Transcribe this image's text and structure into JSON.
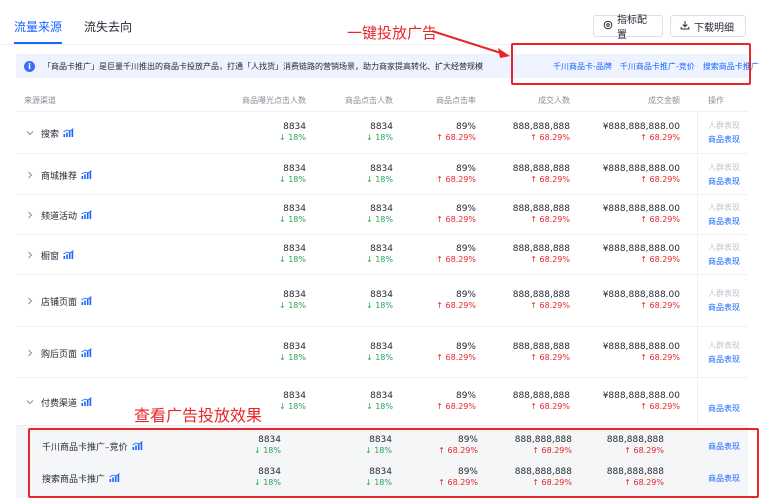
{
  "tabs": [
    {
      "label": "流量来源",
      "active": true
    },
    {
      "label": "流失去向",
      "active": false
    }
  ],
  "toolbar": {
    "metric_label": "指标配置",
    "download_label": "下载明细"
  },
  "notice": {
    "text": "「商品卡推广」是巨量千川推出的商品卡投放产品，打通「人找货」消费链路的营销场景，助力商家提高转化、扩大经营规模",
    "links": [
      "千川商品卡-品牌",
      "千川商品卡推广-竞价",
      "搜索商品卡推广"
    ]
  },
  "annotations": {
    "top": "一键投放广告",
    "bottom": "查看广告投放效果"
  },
  "columns": [
    "来源渠道",
    "商品曝光点击人数",
    "商品点击人数",
    "商品点击率",
    "成交人数",
    "成交金额",
    "操作"
  ],
  "ops": {
    "crowd": "人群表现",
    "product": "商品表现"
  },
  "rows": [
    {
      "name": "搜索",
      "expanded": true,
      "c1": "8834",
      "d1": "↓ 18%",
      "c2": "8834",
      "d2": "↓ 18%",
      "c3": "89%",
      "d3": "↑ 68.29%",
      "c4": "888,888,888",
      "d4": "↑ 68.29%",
      "c5": "¥888,888,888.00",
      "d5": "↑ 68.29%"
    },
    {
      "name": "商城推荐",
      "expanded": false,
      "c1": "8834",
      "d1": "↓ 18%",
      "c2": "8834",
      "d2": "↓ 18%",
      "c3": "89%",
      "d3": "↑ 68.29%",
      "c4": "888,888,888",
      "d4": "↑ 68.29%",
      "c5": "¥888,888,888.00",
      "d5": "↑ 68.29%"
    },
    {
      "name": "频道活动",
      "expanded": false,
      "c1": "8834",
      "d1": "↓ 18%",
      "c2": "8834",
      "d2": "↓ 18%",
      "c3": "89%",
      "d3": "↑ 68.29%",
      "c4": "888,888,888",
      "d4": "↑ 68.29%",
      "c5": "¥888,888,888.00",
      "d5": "↑ 68.29%"
    },
    {
      "name": "橱窗",
      "expanded": false,
      "c1": "8834",
      "d1": "↓ 18%",
      "c2": "8834",
      "d2": "↓ 18%",
      "c3": "89%",
      "d3": "↑ 68.29%",
      "c4": "888,888,888",
      "d4": "↑ 68.29%",
      "c5": "¥888,888,888.00",
      "d5": "↑ 68.29%"
    },
    {
      "name": "店铺页面",
      "expanded": false,
      "c1": "8834",
      "d1": "↓ 18%",
      "c2": "8834",
      "d2": "↓ 18%",
      "c3": "89%",
      "d3": "↑ 68.29%",
      "c4": "888,888,888",
      "d4": "↑ 68.29%",
      "c5": "¥888,888,888.00",
      "d5": "↑ 68.29%"
    },
    {
      "name": "购后页面",
      "expanded": false,
      "c1": "8834",
      "d1": "↓ 18%",
      "c2": "8834",
      "d2": "↓ 18%",
      "c3": "89%",
      "d3": "↑ 68.29%",
      "c4": "888,888,888",
      "d4": "↑ 68.29%",
      "c5": "¥888,888,888.00",
      "d5": "↑ 68.29%"
    },
    {
      "name": "付费渠道",
      "expanded": true,
      "c1": "8834",
      "d1": "↓ 18%",
      "c2": "8834",
      "d2": "↓ 18%",
      "c3": "89%",
      "d3": "↑ 68.29%",
      "c4": "888,888,888",
      "d4": "↑ 68.29%",
      "c5": "¥888,888,888.00",
      "d5": "↑ 68.29%"
    }
  ],
  "sub_rows": [
    {
      "name": "千川商品卡推广–竞价",
      "c1": "8834",
      "d1": "↓ 18%",
      "c2": "8834",
      "d2": "↓ 18%",
      "c3": "89%",
      "d3": "↑ 68.29%",
      "c4": "888,888,888",
      "d4": "↑ 68.29%",
      "c5": "888,888,888",
      "d5": "↑ 68.29%"
    },
    {
      "name": "搜索商品卡推广",
      "c1": "8834",
      "d1": "↓ 18%",
      "c2": "8834",
      "d2": "↓ 18%",
      "c3": "89%",
      "d3": "↑ 68.29%",
      "c4": "888,888,888",
      "d4": "↑ 68.29%",
      "c5": "888,888,888",
      "d5": "↑ 68.29%"
    }
  ],
  "colors": {
    "accent": "#1966ff",
    "down": "#29a35a",
    "up": "#e8262a",
    "annotation": "#e8262a"
  },
  "icons": {
    "row_icon": "trend-chart-icon",
    "expand": "chevron-icon",
    "metric": "settings-icon",
    "download": "download-icon",
    "notice": "info-icon"
  }
}
